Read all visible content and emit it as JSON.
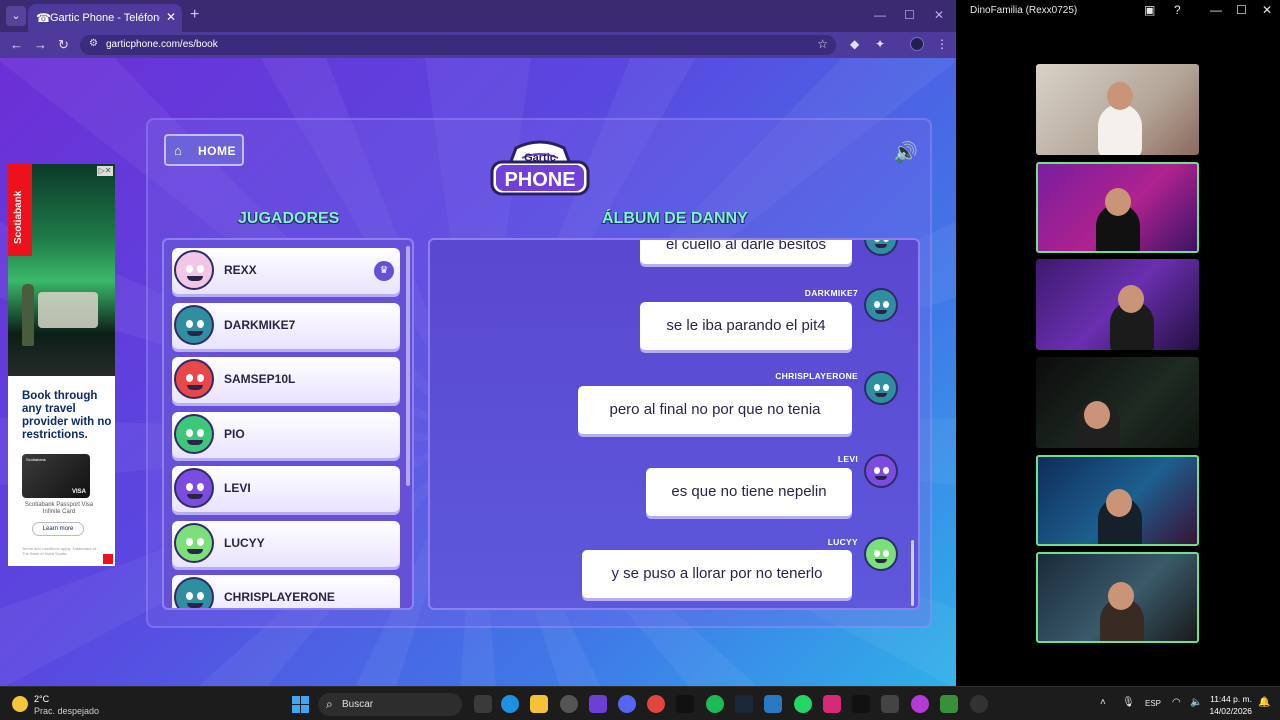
{
  "browser": {
    "tab_title": "Gartic Phone - Teléfono Descon",
    "url": "garticphone.com/es/book"
  },
  "game": {
    "home_label": "HOME",
    "logo_top": "Gartic",
    "logo_bottom": "PHONE",
    "players_heading": "JUGADORES",
    "album_heading": "ÁLBUM DE DANNY",
    "players": [
      {
        "name": "REXX",
        "color": "#f2c7e6",
        "host": true
      },
      {
        "name": "DARKMIKE7",
        "color": "#2f8ea0",
        "host": false
      },
      {
        "name": "SAMSEP10L",
        "color": "#e84848",
        "host": false
      },
      {
        "name": "PIO",
        "color": "#3cc77a",
        "host": false
      },
      {
        "name": "LEVI",
        "color": "#7c4be0",
        "host": false
      },
      {
        "name": "LUCYY",
        "color": "#7be07a",
        "host": false
      },
      {
        "name": "CHRISPLAYERONE",
        "color": "#2f8ea0",
        "host": false
      }
    ],
    "messages": [
      {
        "author": "",
        "text": "el cuello al darle besitos",
        "color": "#2f8ea0"
      },
      {
        "author": "DARKMIKE7",
        "text": "se le iba parando el pit4",
        "color": "#2f8ea0"
      },
      {
        "author": "CHRISPLAYERONE",
        "text": "pero al final no por que no tenia",
        "color": "#2f8ea0"
      },
      {
        "author": "LEVI",
        "text": "es que no tiene nepelin",
        "color": "#7c4be0"
      },
      {
        "author": "LUCYY",
        "text": "y se puso a llorar por no tenerlo",
        "color": "#7be07a"
      }
    ]
  },
  "ad": {
    "brand": "Scotiabank",
    "headline": "Book through any travel provider with no restrictions.",
    "card_name": "Scotiabank Passport Visa Infinite Card",
    "button": "Learn more"
  },
  "call": {
    "title": "DinoFamilia (Rexx0725)"
  },
  "taskbar": {
    "temp": "2°C",
    "weather": "Prac. despejado",
    "search": "Buscar",
    "lang": "ESP",
    "time": "11:44 p. m.",
    "date": "14/02/2026"
  }
}
